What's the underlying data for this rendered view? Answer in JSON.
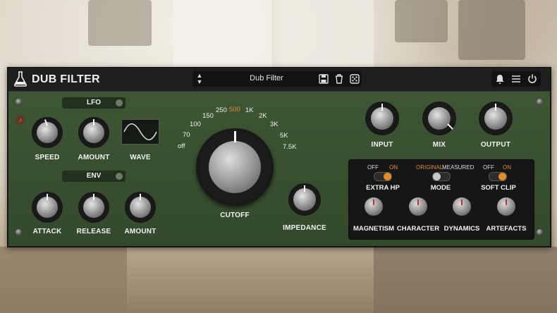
{
  "header": {
    "title": "DUB FILTER",
    "preset_name": "Dub Filter",
    "icons": [
      "save-icon",
      "trash-icon",
      "dice-icon",
      "bell-icon",
      "menu-icon",
      "power-icon"
    ]
  },
  "lfo": {
    "section_label": "LFO",
    "speed_label": "SPEED",
    "amount_label": "AMOUNT",
    "wave_label": "WAVE"
  },
  "env": {
    "section_label": "ENV",
    "attack_label": "ATTACK",
    "release_label": "RELEASE",
    "amount_label": "AMOUNT"
  },
  "cutoff": {
    "label": "CUTOFF",
    "scale": [
      "off",
      "70",
      "100",
      "150",
      "250",
      "500",
      "1K",
      "2K",
      "3K",
      "5K",
      "7.5K"
    ],
    "selected": "500"
  },
  "impedance": {
    "label": "IMPEDANCE"
  },
  "io": {
    "input_label": "INPUT",
    "mix_label": "MIX",
    "output_label": "OUTPUT"
  },
  "rack": {
    "extra_hp": {
      "label": "EXTRA HP",
      "off": "OFF",
      "on": "ON",
      "state": "on"
    },
    "mode": {
      "label": "MODE",
      "option_a": "ORIGINAL",
      "option_b": "MEASURED",
      "state": "original"
    },
    "soft_clip": {
      "label": "SOFT CLIP",
      "off": "OFF",
      "on": "ON",
      "state": "on"
    },
    "knobs": [
      "MAGNETISM",
      "CHARACTER",
      "DYNAMICS",
      "ARTEFACTS"
    ]
  },
  "colors": {
    "accent": "#e28b2b",
    "panel": "#3b5331"
  }
}
